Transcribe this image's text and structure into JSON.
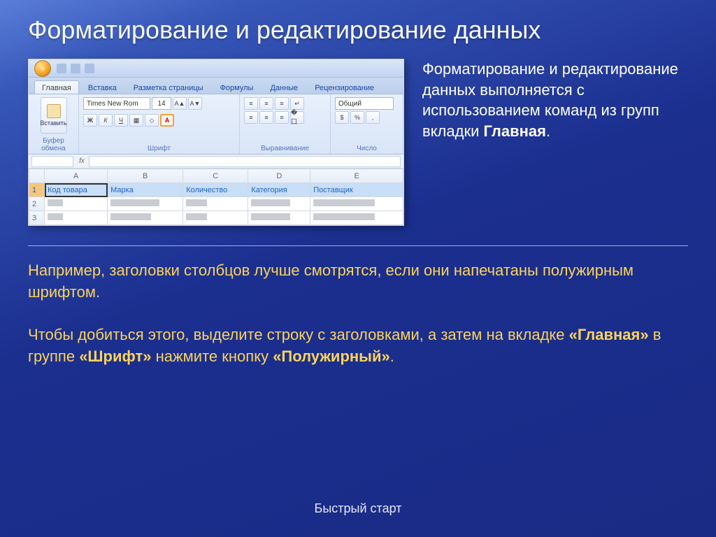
{
  "title": "Форматирование и редактирование данных",
  "excel": {
    "tabs": [
      "Главная",
      "Вставка",
      "Разметка страницы",
      "Формулы",
      "Данные",
      "Рецензирование"
    ],
    "paste_label": "Вставить",
    "group_clipboard": "Буфер обмена",
    "group_font": "Шрифт",
    "group_align": "Выравнивание",
    "group_number": "Число",
    "font_name": "Times New Rom",
    "font_size": "14",
    "number_format": "Общий",
    "bold": "Ж",
    "italic": "К",
    "underline": "Ч",
    "columns": [
      "A",
      "B",
      "C",
      "D",
      "E"
    ],
    "headers": [
      "Код товара",
      "Марка",
      "Количество",
      "Категория",
      "Поставщик"
    ]
  },
  "side": {
    "p1": "Форматирование и редактирование данных выполняется с использованием команд из групп вкладки ",
    "p1b": "Главная"
  },
  "body": {
    "p1": "Например, заголовки столбцов лучше смотрятся, если они напечатаны полужирным шрифтом.",
    "p2a": "Чтобы добиться этого, выделите строку с заголовками, а затем на вкладке ",
    "p2b1": "«Главная»",
    "p2c": " в группе ",
    "p2b2": "«Шрифт»",
    "p2d": " нажмите кнопку ",
    "p2b3": "«Полужирный»"
  },
  "footer": "Быстрый старт"
}
